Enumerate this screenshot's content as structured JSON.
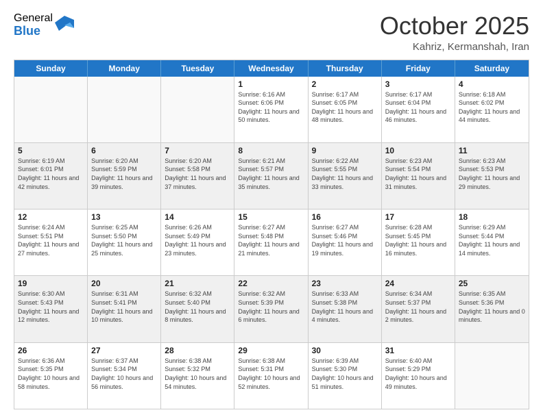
{
  "logo": {
    "general": "General",
    "blue": "Blue"
  },
  "header": {
    "month": "October 2025",
    "location": "Kahriz, Kermanshah, Iran"
  },
  "days_of_week": [
    "Sunday",
    "Monday",
    "Tuesday",
    "Wednesday",
    "Thursday",
    "Friday",
    "Saturday"
  ],
  "weeks": [
    [
      {
        "day": "",
        "sunrise": "",
        "sunset": "",
        "daylight": "",
        "empty": true
      },
      {
        "day": "",
        "sunrise": "",
        "sunset": "",
        "daylight": "",
        "empty": true
      },
      {
        "day": "",
        "sunrise": "",
        "sunset": "",
        "daylight": "",
        "empty": true
      },
      {
        "day": "1",
        "sunrise": "Sunrise: 6:16 AM",
        "sunset": "Sunset: 6:06 PM",
        "daylight": "Daylight: 11 hours and 50 minutes."
      },
      {
        "day": "2",
        "sunrise": "Sunrise: 6:17 AM",
        "sunset": "Sunset: 6:05 PM",
        "daylight": "Daylight: 11 hours and 48 minutes."
      },
      {
        "day": "3",
        "sunrise": "Sunrise: 6:17 AM",
        "sunset": "Sunset: 6:04 PM",
        "daylight": "Daylight: 11 hours and 46 minutes."
      },
      {
        "day": "4",
        "sunrise": "Sunrise: 6:18 AM",
        "sunset": "Sunset: 6:02 PM",
        "daylight": "Daylight: 11 hours and 44 minutes."
      }
    ],
    [
      {
        "day": "5",
        "sunrise": "Sunrise: 6:19 AM",
        "sunset": "Sunset: 6:01 PM",
        "daylight": "Daylight: 11 hours and 42 minutes."
      },
      {
        "day": "6",
        "sunrise": "Sunrise: 6:20 AM",
        "sunset": "Sunset: 5:59 PM",
        "daylight": "Daylight: 11 hours and 39 minutes."
      },
      {
        "day": "7",
        "sunrise": "Sunrise: 6:20 AM",
        "sunset": "Sunset: 5:58 PM",
        "daylight": "Daylight: 11 hours and 37 minutes."
      },
      {
        "day": "8",
        "sunrise": "Sunrise: 6:21 AM",
        "sunset": "Sunset: 5:57 PM",
        "daylight": "Daylight: 11 hours and 35 minutes."
      },
      {
        "day": "9",
        "sunrise": "Sunrise: 6:22 AM",
        "sunset": "Sunset: 5:55 PM",
        "daylight": "Daylight: 11 hours and 33 minutes."
      },
      {
        "day": "10",
        "sunrise": "Sunrise: 6:23 AM",
        "sunset": "Sunset: 5:54 PM",
        "daylight": "Daylight: 11 hours and 31 minutes."
      },
      {
        "day": "11",
        "sunrise": "Sunrise: 6:23 AM",
        "sunset": "Sunset: 5:53 PM",
        "daylight": "Daylight: 11 hours and 29 minutes."
      }
    ],
    [
      {
        "day": "12",
        "sunrise": "Sunrise: 6:24 AM",
        "sunset": "Sunset: 5:51 PM",
        "daylight": "Daylight: 11 hours and 27 minutes."
      },
      {
        "day": "13",
        "sunrise": "Sunrise: 6:25 AM",
        "sunset": "Sunset: 5:50 PM",
        "daylight": "Daylight: 11 hours and 25 minutes."
      },
      {
        "day": "14",
        "sunrise": "Sunrise: 6:26 AM",
        "sunset": "Sunset: 5:49 PM",
        "daylight": "Daylight: 11 hours and 23 minutes."
      },
      {
        "day": "15",
        "sunrise": "Sunrise: 6:27 AM",
        "sunset": "Sunset: 5:48 PM",
        "daylight": "Daylight: 11 hours and 21 minutes."
      },
      {
        "day": "16",
        "sunrise": "Sunrise: 6:27 AM",
        "sunset": "Sunset: 5:46 PM",
        "daylight": "Daylight: 11 hours and 19 minutes."
      },
      {
        "day": "17",
        "sunrise": "Sunrise: 6:28 AM",
        "sunset": "Sunset: 5:45 PM",
        "daylight": "Daylight: 11 hours and 16 minutes."
      },
      {
        "day": "18",
        "sunrise": "Sunrise: 6:29 AM",
        "sunset": "Sunset: 5:44 PM",
        "daylight": "Daylight: 11 hours and 14 minutes."
      }
    ],
    [
      {
        "day": "19",
        "sunrise": "Sunrise: 6:30 AM",
        "sunset": "Sunset: 5:43 PM",
        "daylight": "Daylight: 11 hours and 12 minutes."
      },
      {
        "day": "20",
        "sunrise": "Sunrise: 6:31 AM",
        "sunset": "Sunset: 5:41 PM",
        "daylight": "Daylight: 11 hours and 10 minutes."
      },
      {
        "day": "21",
        "sunrise": "Sunrise: 6:32 AM",
        "sunset": "Sunset: 5:40 PM",
        "daylight": "Daylight: 11 hours and 8 minutes."
      },
      {
        "day": "22",
        "sunrise": "Sunrise: 6:32 AM",
        "sunset": "Sunset: 5:39 PM",
        "daylight": "Daylight: 11 hours and 6 minutes."
      },
      {
        "day": "23",
        "sunrise": "Sunrise: 6:33 AM",
        "sunset": "Sunset: 5:38 PM",
        "daylight": "Daylight: 11 hours and 4 minutes."
      },
      {
        "day": "24",
        "sunrise": "Sunrise: 6:34 AM",
        "sunset": "Sunset: 5:37 PM",
        "daylight": "Daylight: 11 hours and 2 minutes."
      },
      {
        "day": "25",
        "sunrise": "Sunrise: 6:35 AM",
        "sunset": "Sunset: 5:36 PM",
        "daylight": "Daylight: 11 hours and 0 minutes."
      }
    ],
    [
      {
        "day": "26",
        "sunrise": "Sunrise: 6:36 AM",
        "sunset": "Sunset: 5:35 PM",
        "daylight": "Daylight: 10 hours and 58 minutes."
      },
      {
        "day": "27",
        "sunrise": "Sunrise: 6:37 AM",
        "sunset": "Sunset: 5:34 PM",
        "daylight": "Daylight: 10 hours and 56 minutes."
      },
      {
        "day": "28",
        "sunrise": "Sunrise: 6:38 AM",
        "sunset": "Sunset: 5:32 PM",
        "daylight": "Daylight: 10 hours and 54 minutes."
      },
      {
        "day": "29",
        "sunrise": "Sunrise: 6:38 AM",
        "sunset": "Sunset: 5:31 PM",
        "daylight": "Daylight: 10 hours and 52 minutes."
      },
      {
        "day": "30",
        "sunrise": "Sunrise: 6:39 AM",
        "sunset": "Sunset: 5:30 PM",
        "daylight": "Daylight: 10 hours and 51 minutes."
      },
      {
        "day": "31",
        "sunrise": "Sunrise: 6:40 AM",
        "sunset": "Sunset: 5:29 PM",
        "daylight": "Daylight: 10 hours and 49 minutes."
      },
      {
        "day": "",
        "sunrise": "",
        "sunset": "",
        "daylight": "",
        "empty": true
      }
    ]
  ]
}
